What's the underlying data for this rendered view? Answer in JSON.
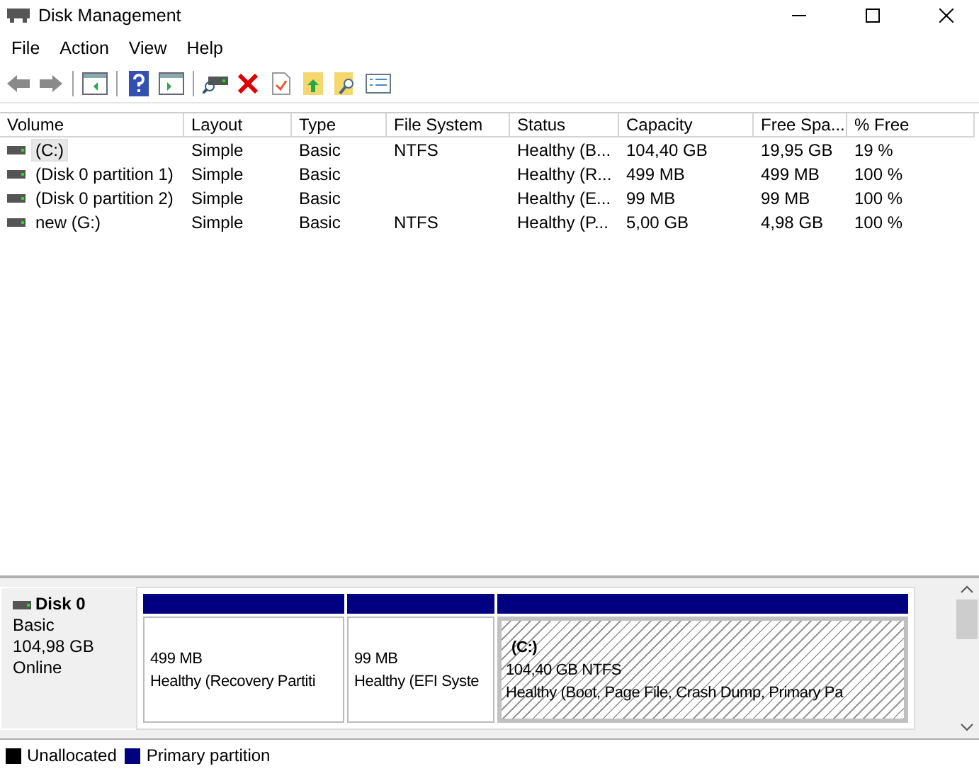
{
  "window": {
    "title": "Disk Management"
  },
  "menu": [
    "File",
    "Action",
    "View",
    "Help"
  ],
  "toolbar": [
    {
      "kind": "back",
      "disabled": true
    },
    {
      "kind": "forward",
      "disabled": true
    },
    {
      "kind": "sep"
    },
    {
      "kind": "tree"
    },
    {
      "kind": "sep"
    },
    {
      "kind": "help"
    },
    {
      "kind": "pane"
    },
    {
      "kind": "sep"
    },
    {
      "kind": "drive"
    },
    {
      "kind": "delete"
    },
    {
      "kind": "check"
    },
    {
      "kind": "folderup"
    },
    {
      "kind": "foldersearch"
    },
    {
      "kind": "list"
    }
  ],
  "table": {
    "columns": [
      "Volume",
      "Layout",
      "Type",
      "File System",
      "Status",
      "Capacity",
      "Free Spa...",
      "% Free"
    ],
    "rows": [
      {
        "selected": true,
        "cells": [
          "(C:)",
          "Simple",
          "Basic",
          "NTFS",
          "Healthy (B...",
          "104,40 GB",
          "19,95 GB",
          "19 %"
        ]
      },
      {
        "selected": false,
        "cells": [
          "(Disk 0 partition 1)",
          "Simple",
          "Basic",
          "",
          "Healthy (R...",
          "499 MB",
          "499 MB",
          "100 %"
        ]
      },
      {
        "selected": false,
        "cells": [
          "(Disk 0 partition 2)",
          "Simple",
          "Basic",
          "",
          "Healthy (E...",
          "99 MB",
          "99 MB",
          "100 %"
        ]
      },
      {
        "selected": false,
        "cells": [
          "new (G:)",
          "Simple",
          "Basic",
          "NTFS",
          "Healthy (P...",
          "5,00 GB",
          "4,98 GB",
          "100 %"
        ]
      }
    ]
  },
  "disk": {
    "name": "Disk 0",
    "type": "Basic",
    "size": "104,98 GB",
    "state": "Online",
    "partitions": [
      {
        "selected": false,
        "size": "499 MB",
        "status": "Healthy (Recovery Partiti"
      },
      {
        "selected": false,
        "size": "99 MB",
        "status": "Healthy (EFI Syste"
      },
      {
        "selected": true,
        "label": "(C:)",
        "size": "104,40 GB NTFS",
        "status": "Healthy (Boot, Page File, Crash Dump, Primary Pa"
      }
    ]
  },
  "legend": [
    {
      "label": "Unallocated",
      "color": "#000000"
    },
    {
      "label": "Primary partition",
      "color": "#000080"
    }
  ]
}
